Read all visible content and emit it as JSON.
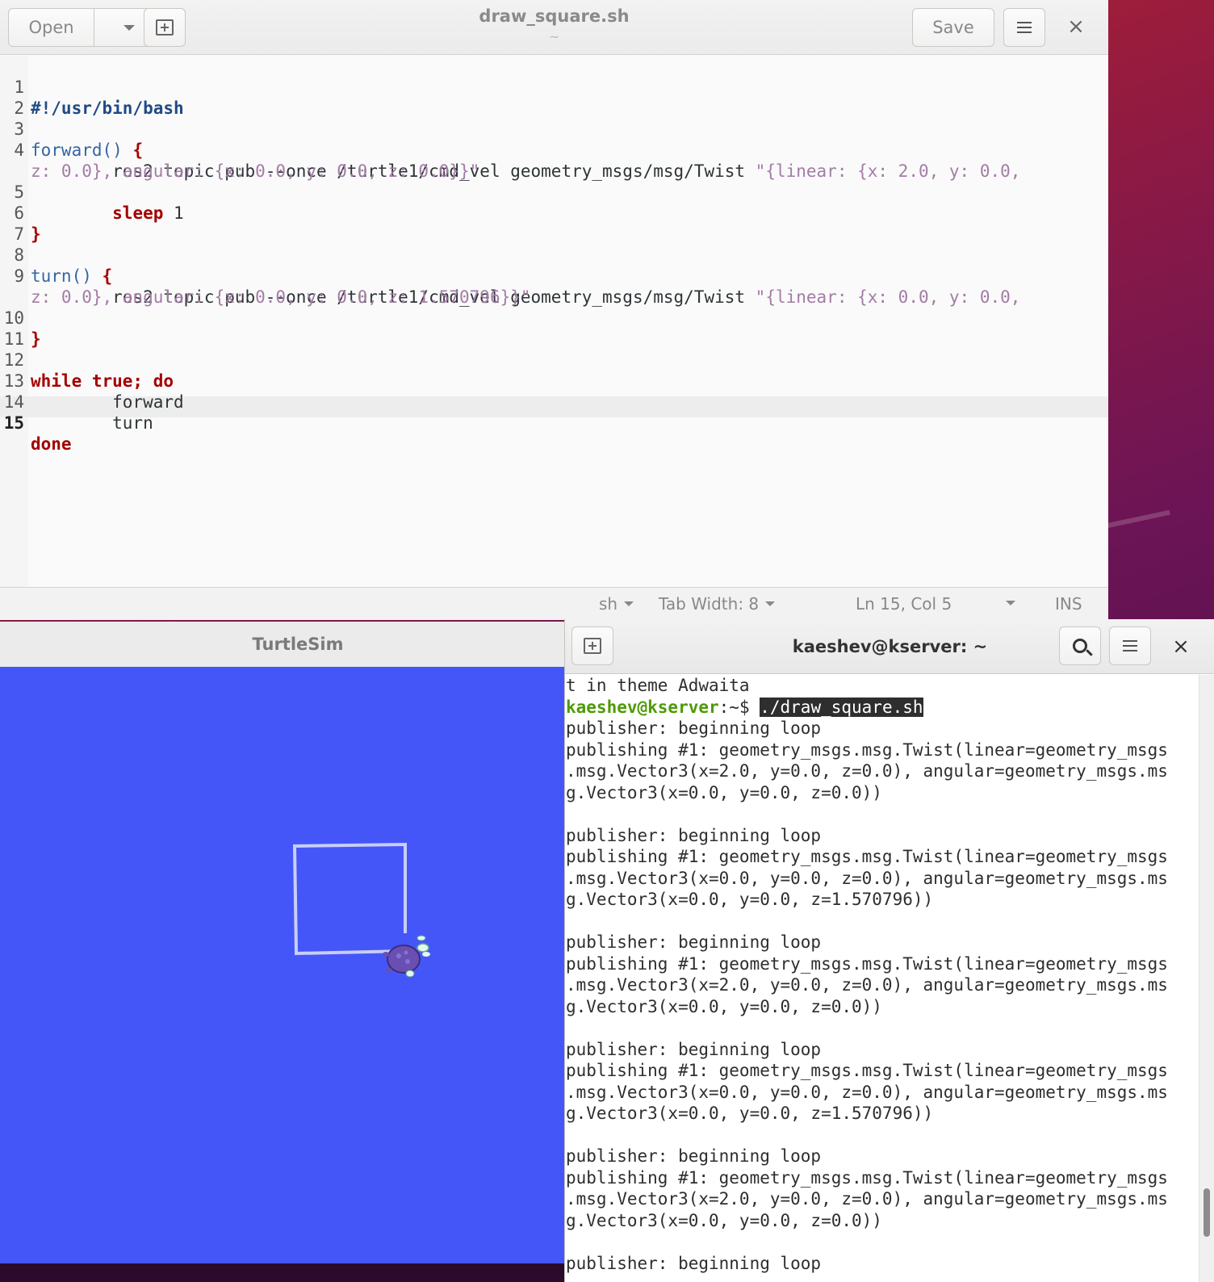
{
  "gedit": {
    "title": "draw_square.sh",
    "subtitle": "~",
    "open_label": "Open",
    "save_label": "Save",
    "lines": [
      {
        "num": "1"
      },
      {
        "num": "2"
      },
      {
        "num": "3"
      },
      {
        "num": "4"
      },
      {
        "num": "5"
      },
      {
        "num": "6"
      },
      {
        "num": "7"
      },
      {
        "num": "8"
      },
      {
        "num": "9"
      },
      {
        "num": "10"
      },
      {
        "num": "11"
      },
      {
        "num": "12"
      },
      {
        "num": "13"
      },
      {
        "num": "14"
      },
      {
        "num": "15"
      }
    ],
    "code": {
      "l1": "#!/usr/bin/bash",
      "l3_fn": "forward()",
      "l3_brace": "{",
      "l4_cmd": "        ros2 topic pub --once /turtle1/cmd_vel geometry_msgs/msg/Twist ",
      "l4_str": "\"{linear: {x: 2.0, y: 0.0,",
      "l4_cont": "z: 0.0}, angular: {x: 0.0, y: 0.0, z: 0.0}}\"",
      "l5_indent": "        ",
      "l5_kw": "sleep",
      "l5_arg": " 1",
      "l6": "}",
      "l8_fn": "turn()",
      "l8_brace": "{",
      "l9_cmd": "        ros2 topic pub --once /turtle1/cmd_vel geometry_msgs/msg/Twist ",
      "l9_str": "\"{linear: {x: 0.0, y: 0.0,",
      "l9_cont": "z: 0.0}, angular: {x: 0.0, y: 0.0, z: 1.570796}}\"",
      "l10": "}",
      "l12_kw": "while true; do",
      "l13": "        forward",
      "l14": "        turn",
      "l15_kw": "done"
    },
    "status": {
      "language": "sh",
      "tab_width": "Tab Width: 8",
      "position": "Ln 15, Col 5",
      "mode": "INS"
    }
  },
  "turtlesim": {
    "title": "TurtleSim",
    "background": "#4556f9"
  },
  "terminal": {
    "title": "kaeshev@kserver: ~",
    "prompt_user": "kaeshev@kserver",
    "prompt_path": ":~$ ",
    "command": "./draw_square.sh",
    "first_line": "t in theme Adwaita",
    "output": [
      "publisher: beginning loop",
      "publishing #1: geometry_msgs.msg.Twist(linear=geometry_msgs",
      ".msg.Vector3(x=2.0, y=0.0, z=0.0), angular=geometry_msgs.ms",
      "g.Vector3(x=0.0, y=0.0, z=0.0))",
      "",
      "publisher: beginning loop",
      "publishing #1: geometry_msgs.msg.Twist(linear=geometry_msgs",
      ".msg.Vector3(x=0.0, y=0.0, z=0.0), angular=geometry_msgs.ms",
      "g.Vector3(x=0.0, y=0.0, z=1.570796))",
      "",
      "publisher: beginning loop",
      "publishing #1: geometry_msgs.msg.Twist(linear=geometry_msgs",
      ".msg.Vector3(x=2.0, y=0.0, z=0.0), angular=geometry_msgs.ms",
      "g.Vector3(x=0.0, y=0.0, z=0.0))",
      "",
      "publisher: beginning loop",
      "publishing #1: geometry_msgs.msg.Twist(linear=geometry_msgs",
      ".msg.Vector3(x=0.0, y=0.0, z=0.0), angular=geometry_msgs.ms",
      "g.Vector3(x=0.0, y=0.0, z=1.570796))",
      "",
      "publisher: beginning loop",
      "publishing #1: geometry_msgs.msg.Twist(linear=geometry_msgs",
      ".msg.Vector3(x=2.0, y=0.0, z=0.0), angular=geometry_msgs.ms",
      "g.Vector3(x=0.0, y=0.0, z=0.0))",
      "",
      "publisher: beginning loop"
    ]
  },
  "icons": {
    "open_dropdown": "chevron-down-icon",
    "new_tab": "new-tab-icon",
    "menu": "hamburger-menu-icon",
    "close": "close-icon",
    "search": "search-icon"
  }
}
